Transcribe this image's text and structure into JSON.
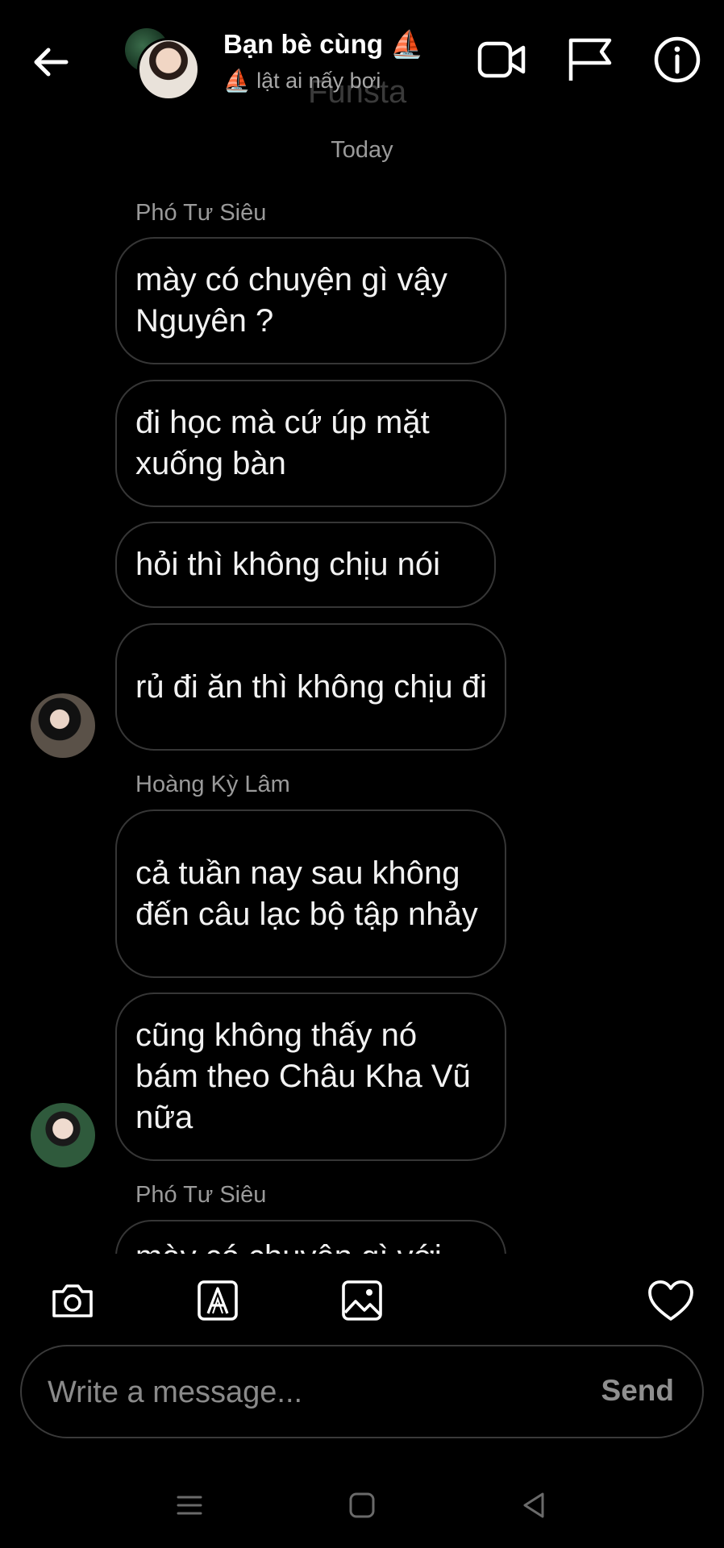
{
  "header": {
    "title": "Bạn bè cùng ⛵",
    "subtitle": "⛵ lật ai nấy bơi",
    "ghost_text": "Funsta",
    "icons": [
      "back-arrow-icon",
      "video-call-icon",
      "flag-icon",
      "info-icon"
    ]
  },
  "chat": {
    "date_label": "Today",
    "groups": [
      {
        "sender": "Phó Tư Siêu",
        "messages": [
          "mày có chuyện gì vậy Nguyên ?",
          "đi học mà cứ úp mặt xuống bàn",
          "hỏi thì không chịu nói",
          "rủ đi ăn thì không chịu đi"
        ]
      },
      {
        "sender": "Hoàng Kỳ Lâm",
        "messages": [
          "cả tuần nay sau không đến câu lạc bộ tập nhảy",
          "cũng không thấy nó bám theo Châu Kha Vũ nữa"
        ]
      },
      {
        "sender": "Phó Tư Siêu",
        "messages": [
          "mày có chuyện gì với"
        ]
      }
    ]
  },
  "toolbar": {
    "icons": [
      "camera-icon",
      "text-style-icon",
      "gallery-icon",
      "heart-icon"
    ]
  },
  "composer": {
    "placeholder": "Write a message...",
    "send_label": "Send"
  },
  "navbar": {
    "icons": [
      "menu-icon",
      "home-icon",
      "back-icon"
    ]
  },
  "colors": {
    "background": "#000000",
    "bubble_border": "#363636",
    "secondary_text": "#9a9a9a"
  }
}
